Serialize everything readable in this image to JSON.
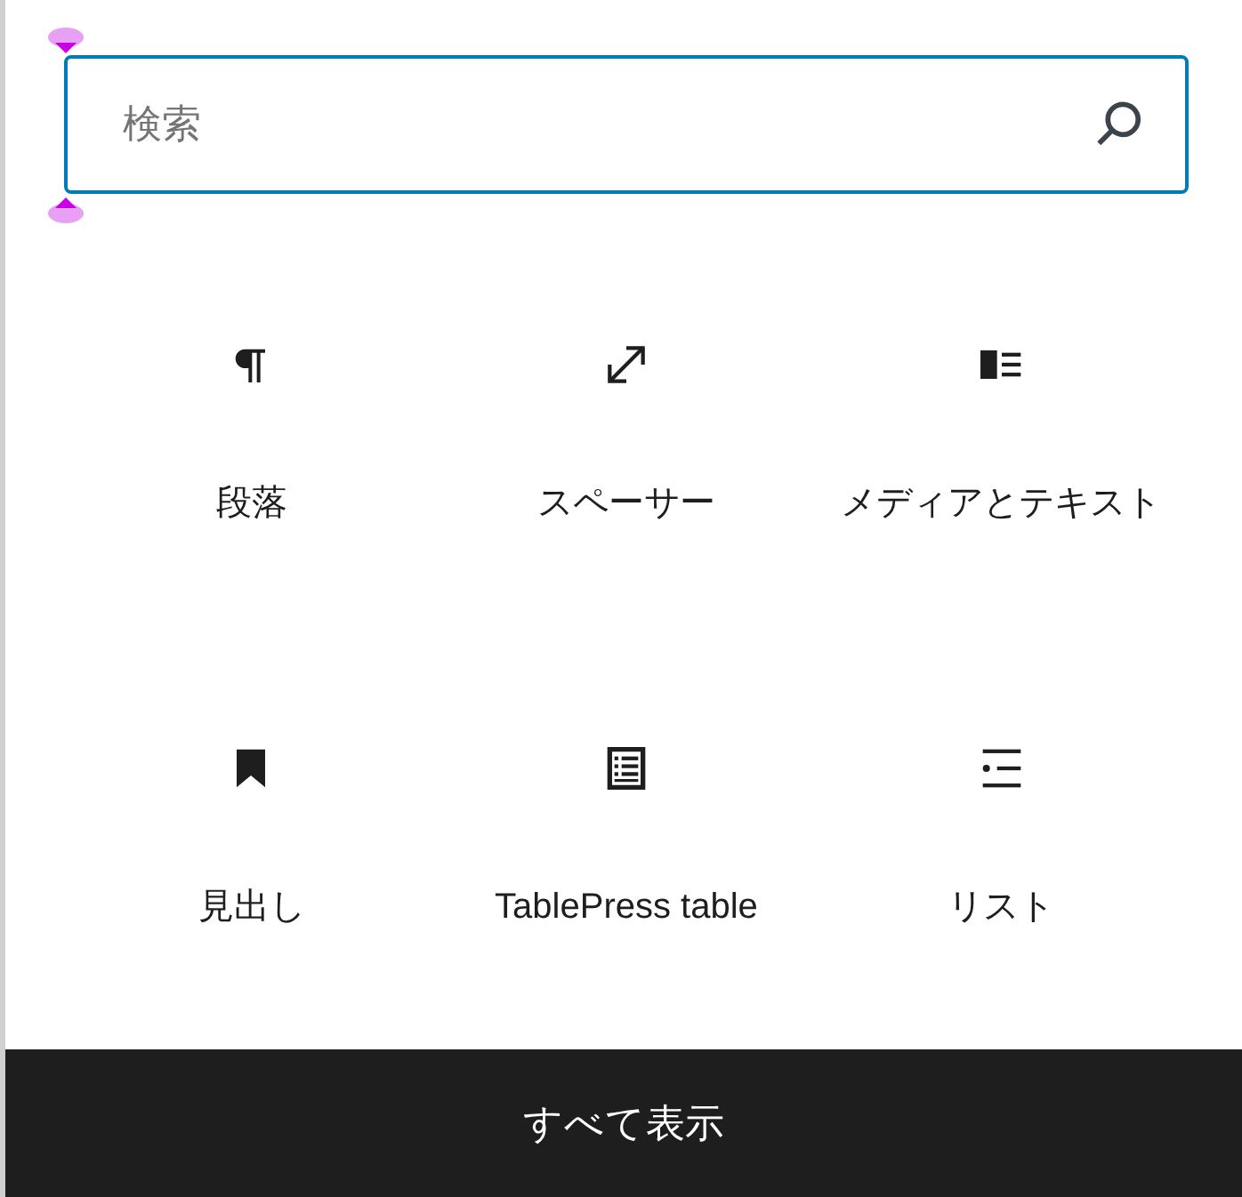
{
  "search": {
    "placeholder": "検索"
  },
  "blocks": [
    {
      "kind": "paragraph",
      "label": "段落"
    },
    {
      "kind": "spacer",
      "label": "スペーサー"
    },
    {
      "kind": "media-text",
      "label": "メディアとテキスト"
    },
    {
      "kind": "heading",
      "label": "見出し"
    },
    {
      "kind": "table",
      "label": "TablePress table"
    },
    {
      "kind": "list",
      "label": "リスト"
    }
  ],
  "footer_button": "すべて表示"
}
